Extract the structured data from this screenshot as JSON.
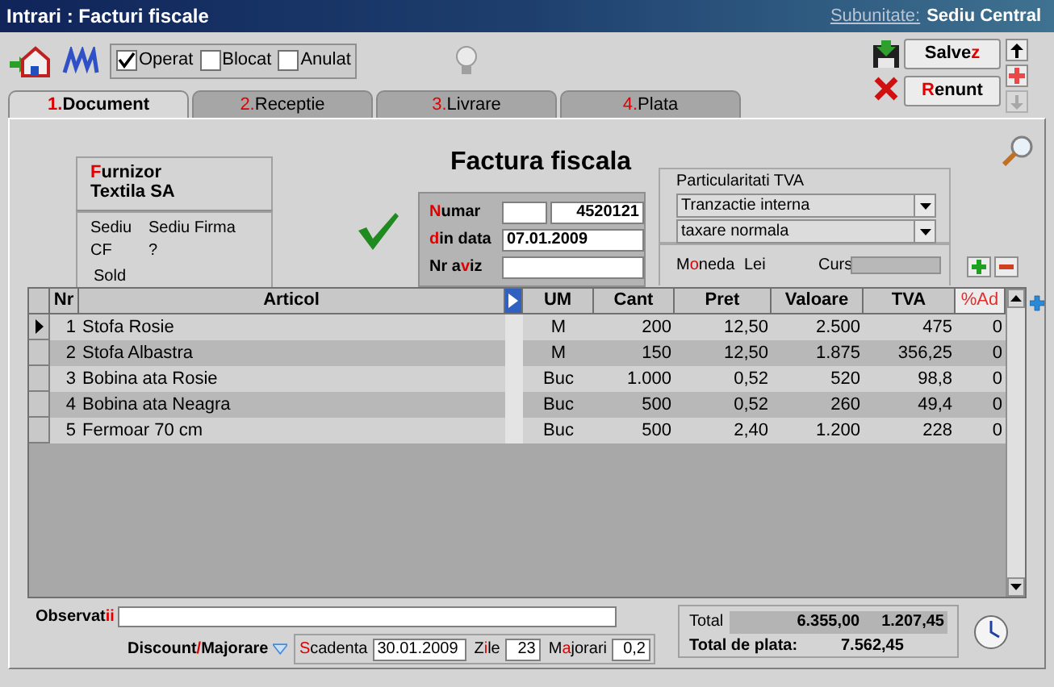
{
  "window": {
    "title": "Intrari : Facturi fiscale",
    "subunit_label": "Subunitate:",
    "subunit_value": "Sediu Central"
  },
  "flags": [
    {
      "label": "Operat",
      "checked": true
    },
    {
      "label": "Blocat",
      "checked": false
    },
    {
      "label": "Anulat",
      "checked": false
    }
  ],
  "buttons": [
    {
      "before": "Salve",
      "key": "z"
    },
    {
      "key": "R",
      "after": "enunt"
    }
  ],
  "tabs": [
    {
      "key": "1.",
      "after": "Document",
      "selected": true
    },
    {
      "key": "2.",
      "after": "Receptie",
      "selected": false
    },
    {
      "key": "3.",
      "after": "Livrare",
      "selected": false
    },
    {
      "key": "4.",
      "after": "Plata",
      "selected": false
    }
  ],
  "supplier": {
    "label": {
      "key": "F",
      "after": "urnizor"
    },
    "name": "Textila SA",
    "sediu_label": "Sediu",
    "sediu_value": "Sediu Firma",
    "cf_label": "CF",
    "cf_value": "?",
    "sold_label": "Sold"
  },
  "document": {
    "title": "Factura fiscala",
    "numar_label": {
      "key": "N",
      "after": "umar"
    },
    "numar_value": "4520121",
    "date_label": {
      "key": "d",
      "after": "in data"
    },
    "date_value": "07.01.2009",
    "aviz_label": {
      "before": "Nr a",
      "key": "v",
      "after": "iz"
    }
  },
  "tva": {
    "title": "Particularitati TVA",
    "selects": [
      "Tranzactie interna",
      "taxare normala"
    ],
    "currency_label": {
      "before": "M",
      "key": "o",
      "after": "neda"
    },
    "currency_value": "Lei",
    "rate_label": "Curs"
  },
  "table": {
    "columns": [
      "Nr",
      "Articol",
      "UM",
      "Cant",
      "Pret",
      "Valoare",
      "TVA",
      "%Ad"
    ],
    "rows": [
      {
        "selected": true,
        "cells": [
          "1",
          "Stofa Rosie",
          "M",
          "200",
          "12,50",
          "2.500",
          "475",
          "0"
        ]
      },
      {
        "selected": false,
        "cells": [
          "2",
          "Stofa Albastra",
          "M",
          "150",
          "12,50",
          "1.875",
          "356,25",
          "0"
        ]
      },
      {
        "selected": false,
        "cells": [
          "3",
          "Bobina ata Rosie",
          "Buc",
          "1.000",
          "0,52",
          "520",
          "98,8",
          "0"
        ]
      },
      {
        "selected": false,
        "cells": [
          "4",
          "Bobina ata Neagra",
          "Buc",
          "500",
          "0,52",
          "260",
          "49,4",
          "0"
        ]
      },
      {
        "selected": false,
        "cells": [
          "5",
          "Fermoar 70 cm",
          "Buc",
          "500",
          "2,40",
          "1.200",
          "228",
          "0"
        ]
      }
    ]
  },
  "footer": {
    "notes_label": {
      "before": "Observat",
      "key": "ii"
    },
    "discount_label": {
      "before": "Discount",
      "key": "/",
      "after": "Majorare"
    },
    "due_label": {
      "key": "S",
      "after": "cadenta"
    },
    "due_value": "30.01.2009",
    "days_label": {
      "before": "Z",
      "key": "i",
      "after": "le"
    },
    "days_value": "23",
    "penalty_label": {
      "before": "M",
      "key": "a",
      "after": "jorari"
    },
    "penalty_value": "0,2"
  },
  "totals": {
    "label": "Total",
    "value": "6.355,00",
    "vat": "1.207,45",
    "grand_label": "Total de plata:",
    "grand_value": "7.562,45"
  }
}
